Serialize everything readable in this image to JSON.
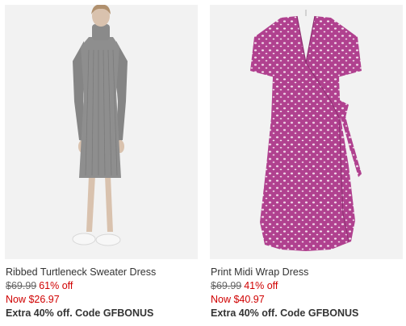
{
  "products": [
    {
      "title": "Ribbed Turtleneck Sweater Dress",
      "original_price": "$69.99",
      "discount": "61% off",
      "now_price": "Now $26.97",
      "promo": "Extra 40% off. Code GFBONUS",
      "image": "gray-turtleneck-sweater-dress-photo",
      "colors": {
        "dress": "#8e8e8e",
        "background": "#f2f2f2"
      }
    },
    {
      "title": "Print Midi Wrap Dress",
      "original_price": "$69.99",
      "discount": "41% off",
      "now_price": "Now $40.97",
      "promo": "Extra 40% off. Code GFBONUS",
      "image": "magenta-print-wrap-dress-photo",
      "colors": {
        "dress": "#b0418f",
        "background": "#f2f2f2"
      }
    }
  ],
  "colors": {
    "sale_red": "#d00000",
    "text": "#333333",
    "strikethrough": "#666666"
  }
}
